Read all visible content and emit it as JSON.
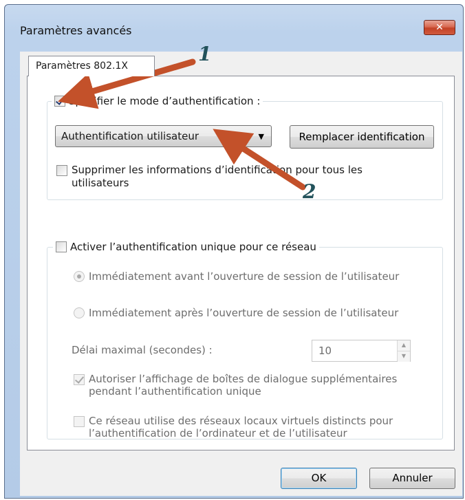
{
  "window": {
    "title": "Paramètres avancés",
    "close_glyph": "✕"
  },
  "tabs": [
    {
      "label": "Paramètres 802.1X"
    }
  ],
  "auth_group": {
    "specify_label": "Spécifier le mode d’authentification :",
    "specify_checked": true,
    "mode_selected": "Authentification utilisateur",
    "replace_button": "Remplacer identification",
    "delete_label": "Supprimer les informations d’identification pour tous les utilisateurs",
    "delete_checked": false
  },
  "sso_group": {
    "enable_label": "Activer l’authentification unique pour ce réseau",
    "enable_checked": false,
    "radio_before": "Immédiatement avant l’ouverture de session de l’utilisateur",
    "radio_after": "Immédiatement après l’ouverture de session de l’utilisateur",
    "delay_label": "Délai maximal (secondes) :",
    "delay_value": "10",
    "allow_dialogs_label": "Autoriser l’affichage de boîtes de dialogue supplémentaires pendant l’authentification unique",
    "vlan_label": "Ce réseau utilise des réseaux locaux virtuels distincts pour l’authentification de l’ordinateur et de l’utilisateur"
  },
  "buttons": {
    "ok": "OK",
    "cancel": "Annuler"
  },
  "annotations": {
    "one": "1",
    "two": "2",
    "arrow_color": "#c3512a"
  }
}
